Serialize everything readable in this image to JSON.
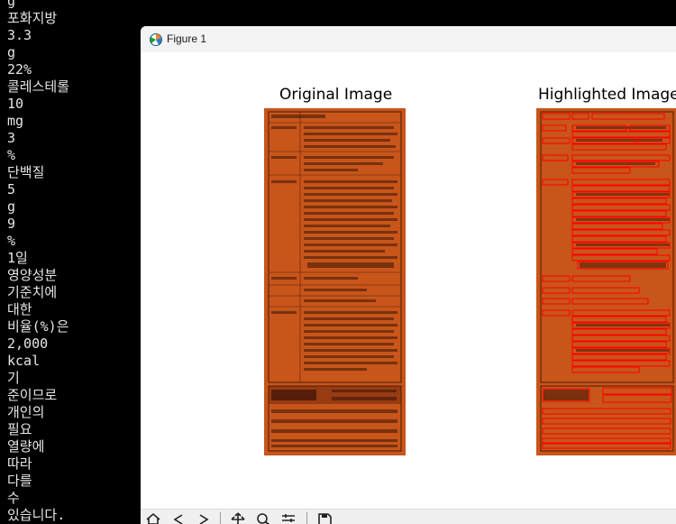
{
  "terminal": {
    "lines": [
      "g",
      "포화지방",
      "3.3",
      "g",
      "22%",
      "콜레스테롤",
      "10",
      "mg",
      "3",
      "%",
      "단백질",
      "5",
      "g",
      "9",
      "%",
      "1일",
      "영양성분",
      "기준치에",
      "대한",
      "비율(%)은",
      "2,000",
      "kcal",
      "기",
      "준이므로",
      "개인의",
      "필요",
      "열량에",
      "따라",
      "다를",
      "수",
      "있습니다."
    ]
  },
  "window": {
    "title": "Figure 1",
    "icon": "matplotlib-figure-icon"
  },
  "plots": {
    "left_title": "Original Image",
    "right_title": "Highlighted Image"
  },
  "toolbar": {
    "icons": [
      "home-icon",
      "back-icon",
      "forward-icon",
      "pan-icon",
      "zoom-icon",
      "configure-icon",
      "save-icon"
    ]
  },
  "colors": {
    "label_background": "#c8551a",
    "highlight_box": "#ff0000",
    "terminal_background": "#000000",
    "terminal_text": "#e6e6e6"
  }
}
